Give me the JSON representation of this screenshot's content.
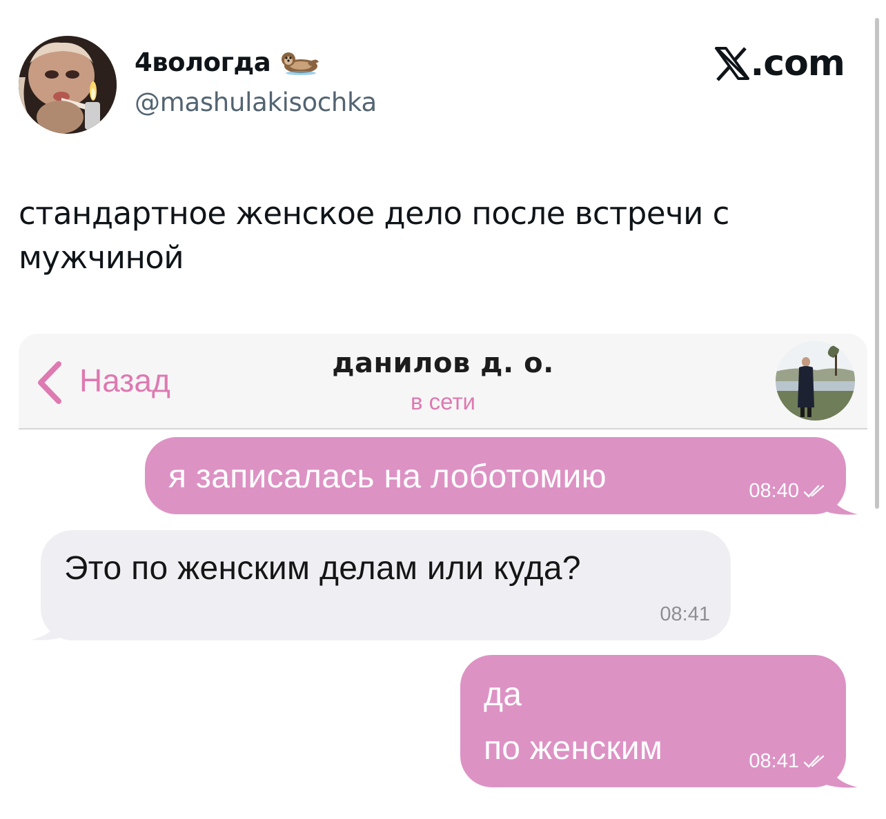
{
  "tweet": {
    "display_name": "4вологда",
    "name_emoji_icon": "otter-icon",
    "handle": "@mashulakisochka",
    "site_brand_suffix": ".com",
    "site_brand_icon": "x-logo-icon",
    "text": "стандартное женское дело после встречи с мужчиной"
  },
  "chat": {
    "back_label": "Назад",
    "contact_name": "данилов д. о.",
    "contact_status": "в сети",
    "accent_color": "#de79b1",
    "outgoing_bubble_color": "#dd92c4",
    "incoming_bubble_color": "#efeef3",
    "messages": [
      {
        "direction": "outgoing",
        "lines": [
          "я записалась на лоботомию"
        ],
        "time": "08:40",
        "status_icon": "double-check-icon"
      },
      {
        "direction": "incoming",
        "lines": [
          "Это по женским делам или куда?"
        ],
        "time": "08:41"
      },
      {
        "direction": "outgoing",
        "lines": [
          "да",
          "по женским"
        ],
        "time": "08:41",
        "status_icon": "double-check-icon"
      }
    ]
  }
}
